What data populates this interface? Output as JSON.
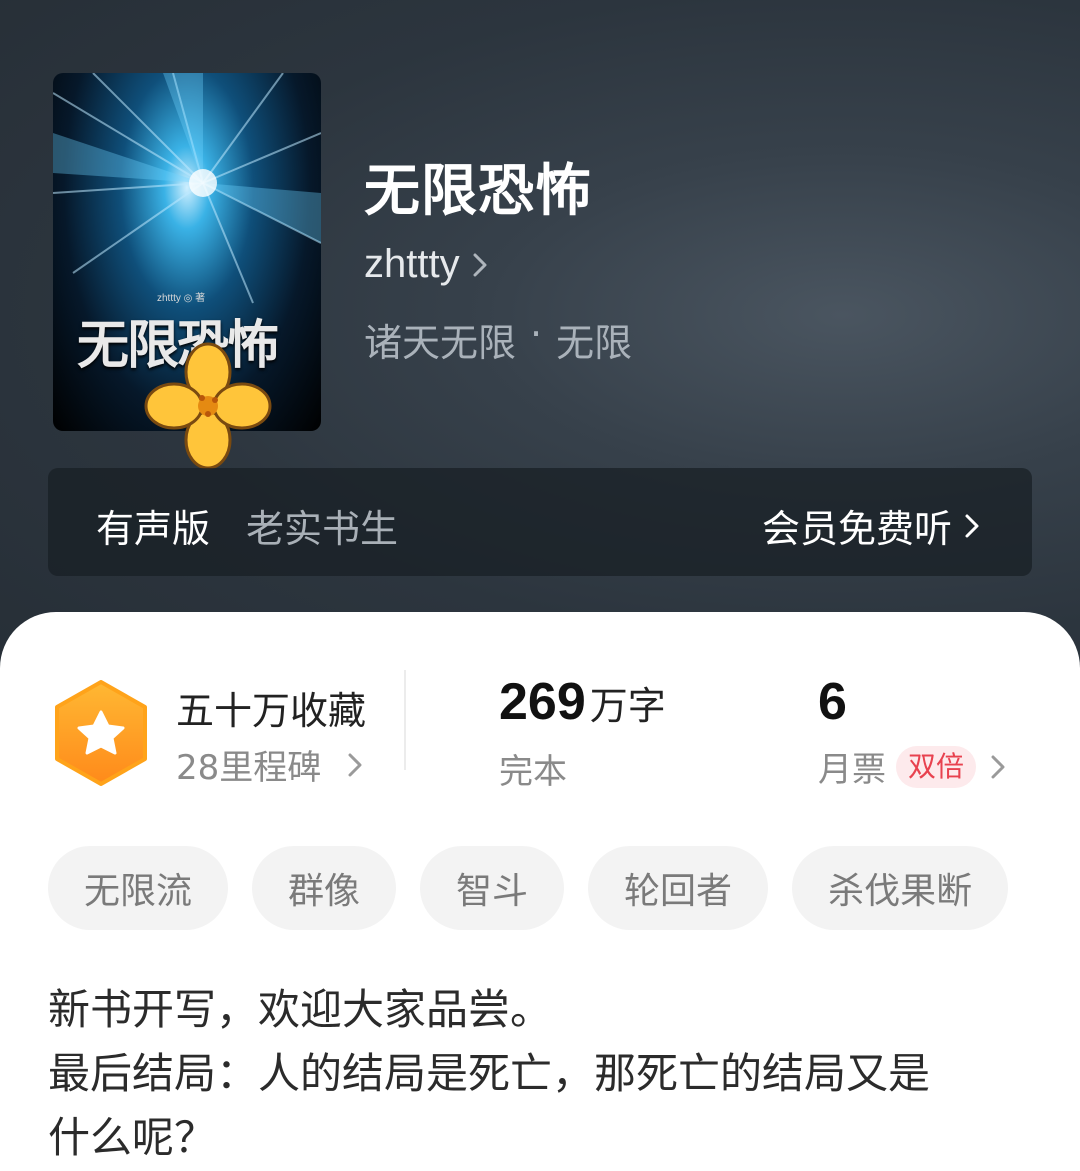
{
  "book": {
    "title": "无限恐怖",
    "author": "zhttty",
    "genre_primary": "诸天无限",
    "genre_separator": "·",
    "genre_secondary": "无限",
    "cover": {
      "title": "无限恐怖",
      "author_line": "zhttty ◎ 著"
    }
  },
  "audio": {
    "label": "有声版",
    "narrator": "老实书生",
    "action": "会员免费听"
  },
  "stats": {
    "collect_label": "五十万收藏",
    "milestone_label": "28里程碑",
    "word_count": "269",
    "word_unit": "万字",
    "status": "完本",
    "monthly_ticket_count": "6",
    "monthly_ticket_label": "月票",
    "double_badge": "双倍"
  },
  "tags": [
    "无限流",
    "群像",
    "智斗",
    "轮回者",
    "杀伐果断"
  ],
  "description": {
    "line1": "新书开写，欢迎大家品尝。",
    "line2": "最后结局：人的结局是死亡，那死亡的结局又是",
    "line3": "什么呢？"
  },
  "colors": {
    "hero_bg": "#2c353e",
    "badge_orange": "#ffa31a",
    "double_red": "#e8424f"
  },
  "icons": [
    "chevron-right-icon",
    "star-hexagon-icon",
    "flower-sticker-icon"
  ]
}
